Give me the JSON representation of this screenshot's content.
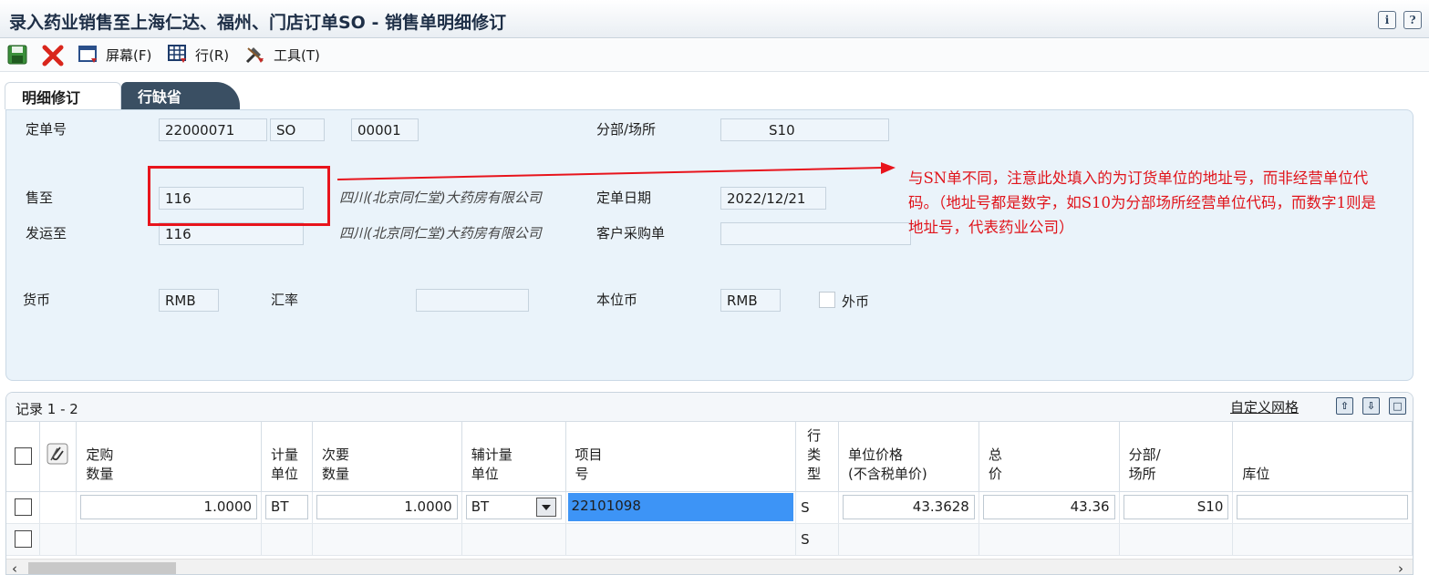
{
  "window": {
    "title": "录入药业销售至上海仁达、福州、门店订单SO - 销售单明细修订"
  },
  "toolbar": {
    "screen_menu": "屏幕(F)",
    "row_menu": "行(R)",
    "tools_menu": "工具(T)"
  },
  "tabs": [
    {
      "label": "明细修订"
    },
    {
      "label": "行缺省"
    }
  ],
  "header": {
    "order_no_label": "定单号",
    "order_no": "22000071",
    "order_type": "SO",
    "order_company": "00001",
    "branch_label": "分部/场所",
    "branch": "S10",
    "sold_to_label": "售至",
    "sold_to": "116",
    "sold_to_name": "四川(北京同仁堂)大药房有限公司",
    "order_date_label": "定单日期",
    "order_date": "2022/12/21",
    "ship_to_label": "发运至",
    "ship_to": "116",
    "ship_to_name": "四川(北京同仁堂)大药房有限公司",
    "customer_po_label": "客户采购单",
    "customer_po": "",
    "currency_label": "货币",
    "currency": "RMB",
    "exchange_rate_label": "汇率",
    "exchange_rate": "",
    "base_currency_label": "本位币",
    "base_currency": "RMB",
    "foreign_currency_label": "外币",
    "foreign_currency_checked": false
  },
  "annotation": {
    "note": "与SN单不同，注意此处填入的为订货单位的地址号，而非经营单位代码。（地址号都是数字，如S10为分部场所经营单位代码，而数字1则是地址号，代表药业公司）",
    "color": "#e0141b"
  },
  "grid": {
    "records": "记录 1 - 2",
    "custom_grid": "自定义网格",
    "columns": [
      {
        "line1": "定购",
        "line2": "数量"
      },
      {
        "line1": "计量",
        "line2": "单位"
      },
      {
        "line1": "次要",
        "line2": "数量"
      },
      {
        "line1": "辅计量",
        "line2": "单位"
      },
      {
        "line1": "项目",
        "line2": "号"
      },
      {
        "line1": "行",
        "line2": "类",
        "line3": "型"
      },
      {
        "line1": "单位价格",
        "line2": "(不含税单价)"
      },
      {
        "line1": "总",
        "line2": "价"
      },
      {
        "line1": "分部/",
        "line2": "场所"
      },
      {
        "line1": "",
        "line2": "库位"
      }
    ],
    "rows": [
      {
        "qty": "1.0000",
        "uom": "BT",
        "sec_qty": "1.0000",
        "sec_uom": "BT",
        "item": "22101098",
        "line_type": "S",
        "unit_price": "43.3628",
        "ext_price": "43.36",
        "branch": "S10",
        "location": ""
      },
      {
        "qty": "",
        "uom": "",
        "sec_qty": "",
        "sec_uom": "",
        "item": "",
        "line_type": "S",
        "unit_price": "",
        "ext_price": "",
        "branch": "",
        "location": ""
      }
    ]
  },
  "colors": {
    "accent_red": "#e8141c",
    "header_panel_bg": "#eaf3fa",
    "tab_inactive_bg": "#3a4f63",
    "selected_cell": "#3d94f6"
  }
}
